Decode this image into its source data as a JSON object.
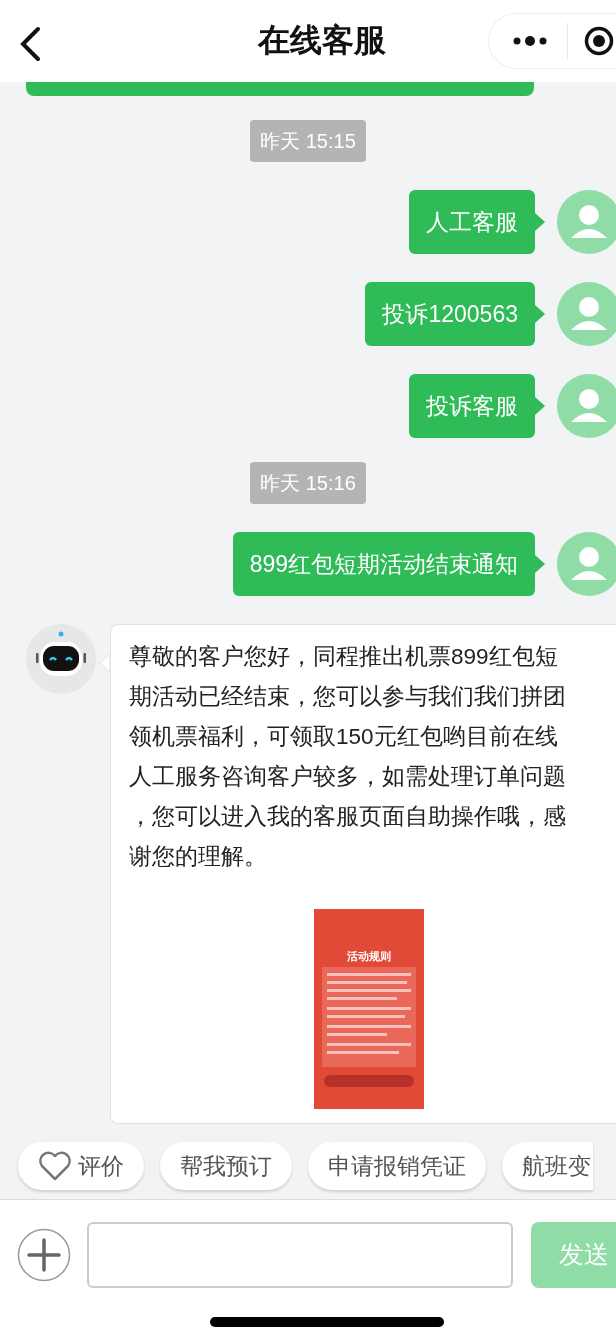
{
  "header": {
    "title": "在线客服"
  },
  "messages": [
    {
      "kind": "cut"
    },
    {
      "kind": "time",
      "text": "昨天 15:15"
    },
    {
      "kind": "sent",
      "text": "人工客服"
    },
    {
      "kind": "sent",
      "text": "投诉1200563"
    },
    {
      "kind": "sent",
      "text": "投诉客服"
    },
    {
      "kind": "time",
      "text": "昨天 15:16"
    },
    {
      "kind": "sent",
      "text": "899红包短期活动结束通知"
    },
    {
      "kind": "received",
      "lines": [
        "尊敬的客户您好，同程推出机票899红包短",
        "期活动已经结束，您可以参与我们我们拼团",
        "领机票福利，可领取150元红包哟目前在线",
        "人工服务咨询客户较多，如需处理订单问题",
        "，您可以进入我的客服页面自助操作哦，感",
        "谢您的理解。"
      ],
      "image": {
        "title": "活动规则"
      }
    }
  ],
  "quick_replies": [
    {
      "kind": "rating",
      "label": "评价"
    },
    {
      "kind": "plain",
      "label": "帮我预订"
    },
    {
      "kind": "plain",
      "label": "申请报销凭证"
    },
    {
      "kind": "plain",
      "label": "航班变"
    }
  ],
  "composer": {
    "send_label": "发送",
    "disabled": true
  }
}
